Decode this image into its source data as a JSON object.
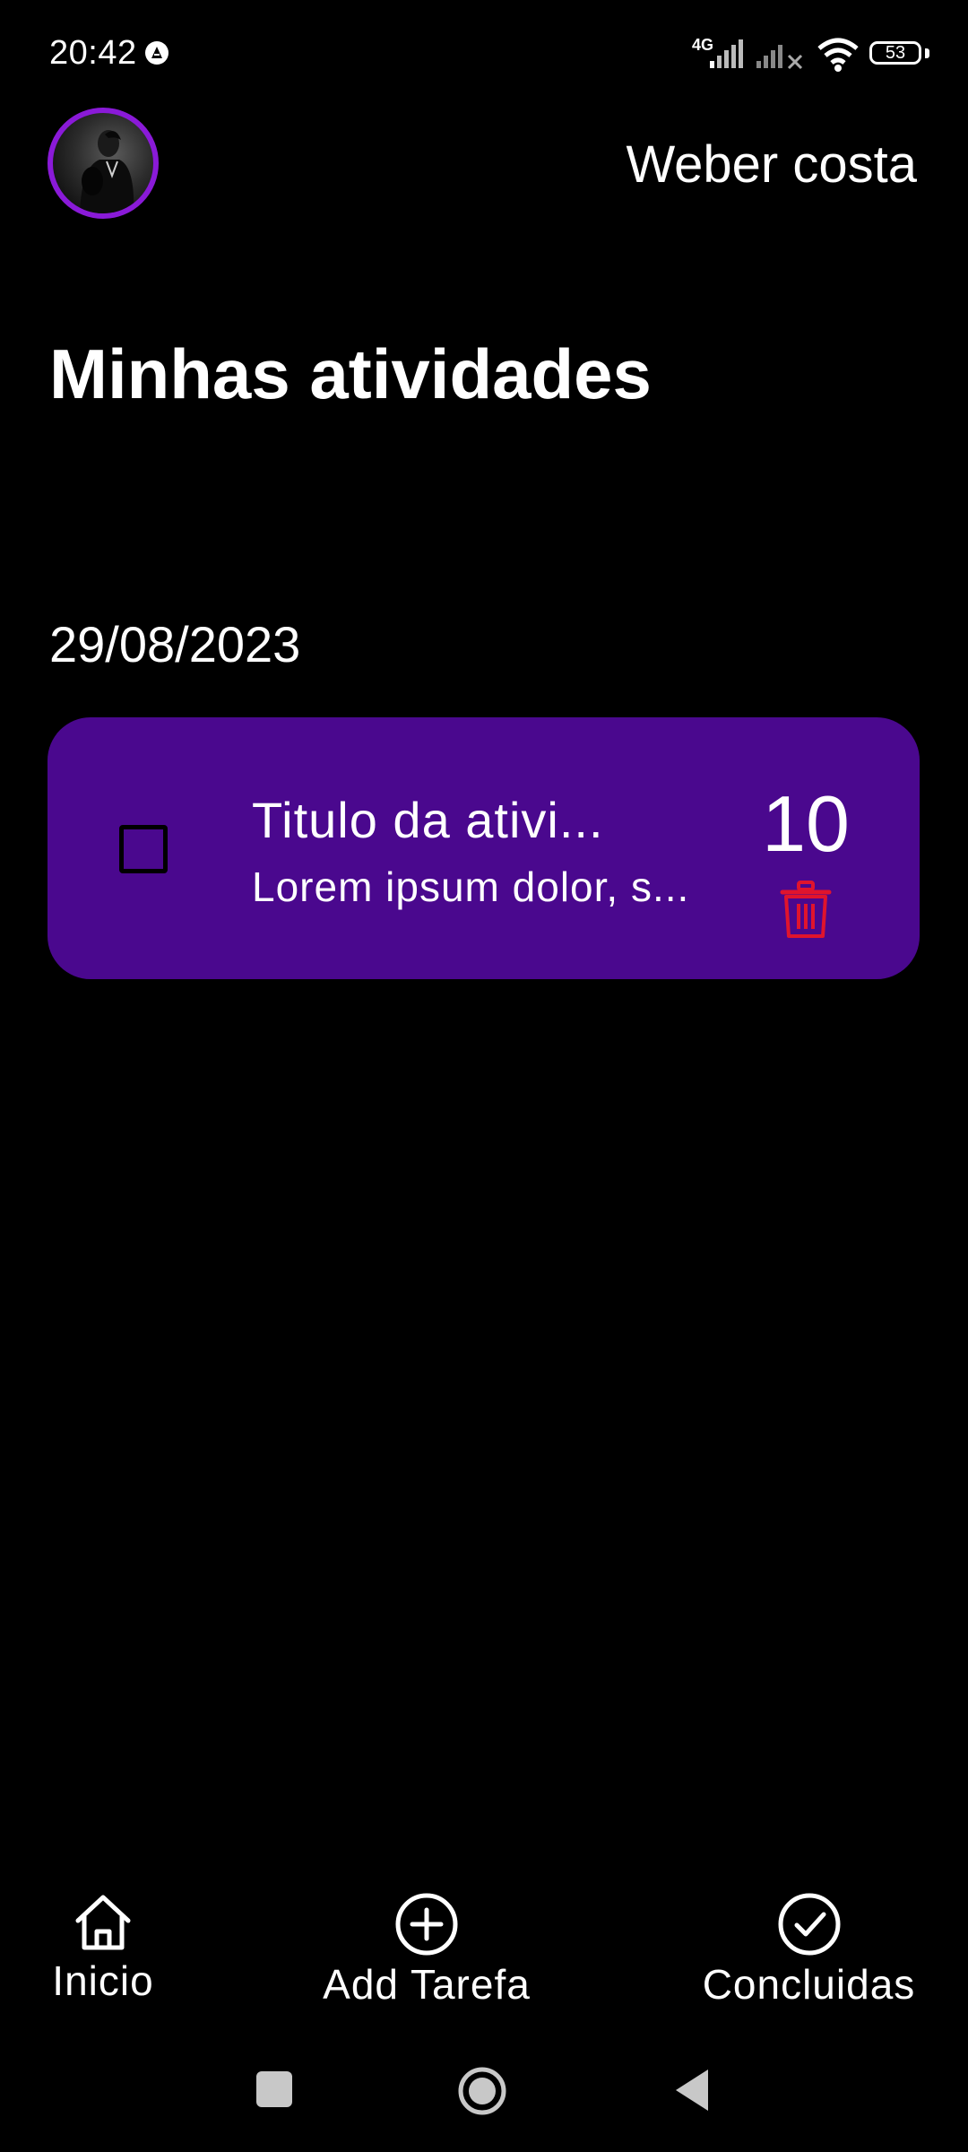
{
  "status_bar": {
    "time": "20:42",
    "network_label": "4G",
    "battery_level": "53",
    "icons": [
      "app-notification-icon",
      "signal-icon",
      "signal-no-service-icon",
      "wifi-icon",
      "battery-icon"
    ]
  },
  "header": {
    "user_name": "Weber costa",
    "avatar_icon": "user-avatar",
    "avatar_ring_color": "#8a1ad8"
  },
  "page": {
    "title": "Minhas atividades",
    "date": "29/08/2023"
  },
  "task": {
    "title": "Titulo da ativi...",
    "description": "Lorem ipsum dolor, s...",
    "number": "10",
    "checked": false,
    "card_color": "#4a088e",
    "delete_icon": "trash-icon",
    "delete_color": "#e0142d"
  },
  "bottom_nav": {
    "items": [
      {
        "label": "Inicio",
        "icon": "home-icon"
      },
      {
        "label": "Add Tarefa",
        "icon": "plus-circle-icon"
      },
      {
        "label": "Concluidas",
        "icon": "check-circle-icon"
      }
    ]
  },
  "system_nav": {
    "icons": [
      "recents-square-icon",
      "home-circle-icon",
      "back-triangle-icon"
    ]
  }
}
